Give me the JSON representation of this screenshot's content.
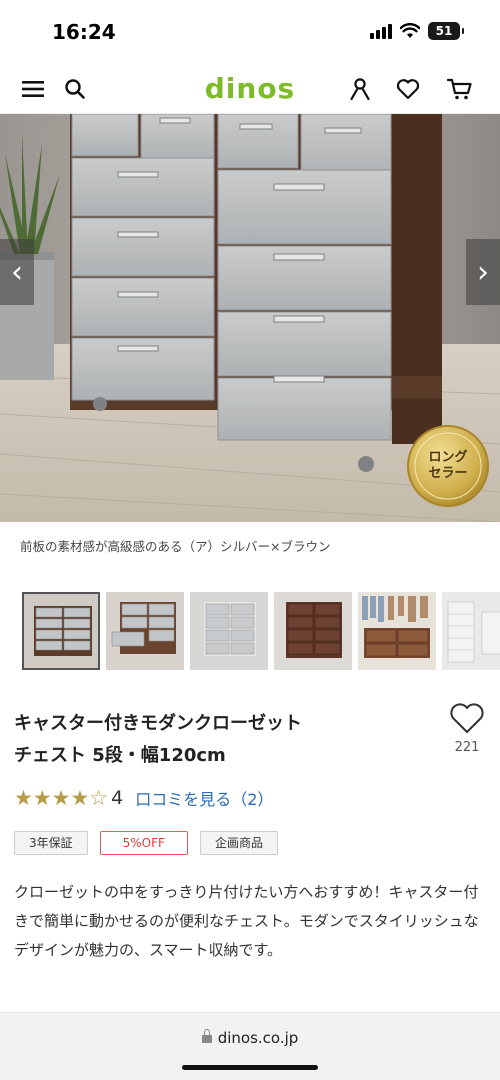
{
  "status_bar": {
    "time": "16:24",
    "battery": "51",
    "icons": [
      "signal-icon",
      "wifi-icon",
      "battery-icon"
    ]
  },
  "header": {
    "logo": "dinos",
    "brand_color": "#7dbb2b",
    "icons": [
      "menu-icon",
      "search-icon",
      "account-icon",
      "heart-icon",
      "cart-icon"
    ]
  },
  "hero": {
    "badge_line1": "ロング",
    "badge_line2": "セラー",
    "prev_glyph": "‹",
    "next_glyph": "›"
  },
  "caption": "前板の素材感が高級感のある（ア）シルバー×ブラウン",
  "thumbnails": [
    {
      "name": "silver-brown-chest-front",
      "selected": true
    },
    {
      "name": "silver-brown-chest-open-drawer",
      "selected": false
    },
    {
      "name": "white-silver-chest",
      "selected": false
    },
    {
      "name": "dark-brown-chest",
      "selected": false
    },
    {
      "name": "closet-wide-chest",
      "selected": false
    },
    {
      "name": "white-tall-chest",
      "selected": false
    }
  ],
  "product": {
    "title_line1": "キャスター付きモダンクローゼット",
    "title_line2": "チェスト 5段・幅120cm",
    "favorite_count": "221",
    "stars": "★★★★☆",
    "rating": "4",
    "review_link": "口コミを見る（2）",
    "badges": {
      "warranty": "3年保証",
      "sale": "5%OFF",
      "original": "企画商品"
    },
    "description": "クローゼットの中をすっきり片付けたい方へおすすめ！キャスター付きで簡単に動かせるのが便利なチェスト。モダンでスタイリッシュなデザインが魅力の、スマート収納です。"
  },
  "browser": {
    "url": "dinos.co.jp"
  }
}
